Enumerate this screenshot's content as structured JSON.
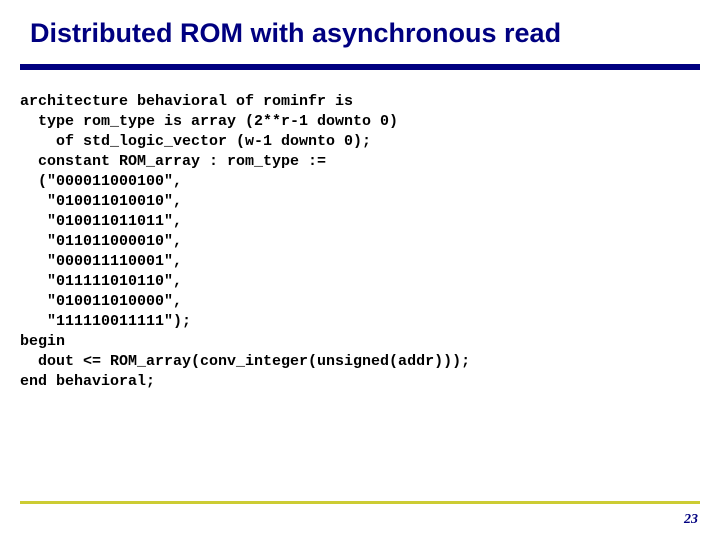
{
  "title": "Distributed ROM with asynchronous read",
  "code": "architecture behavioral of rominfr is\n  type rom_type is array (2**r-1 downto 0)\n    of std_logic_vector (w-1 downto 0);\n  constant ROM_array : rom_type := \n  (\"000011000100\",\n   \"010011010010\",\n   \"010011011011\",\n   \"011011000010\",\n   \"000011110001\",\n   \"011111010110\",\n   \"010011010000\",\n   \"111110011111\");\nbegin\n  dout <= ROM_array(conv_integer(unsigned(addr)));\nend behavioral;",
  "page_number": "23"
}
